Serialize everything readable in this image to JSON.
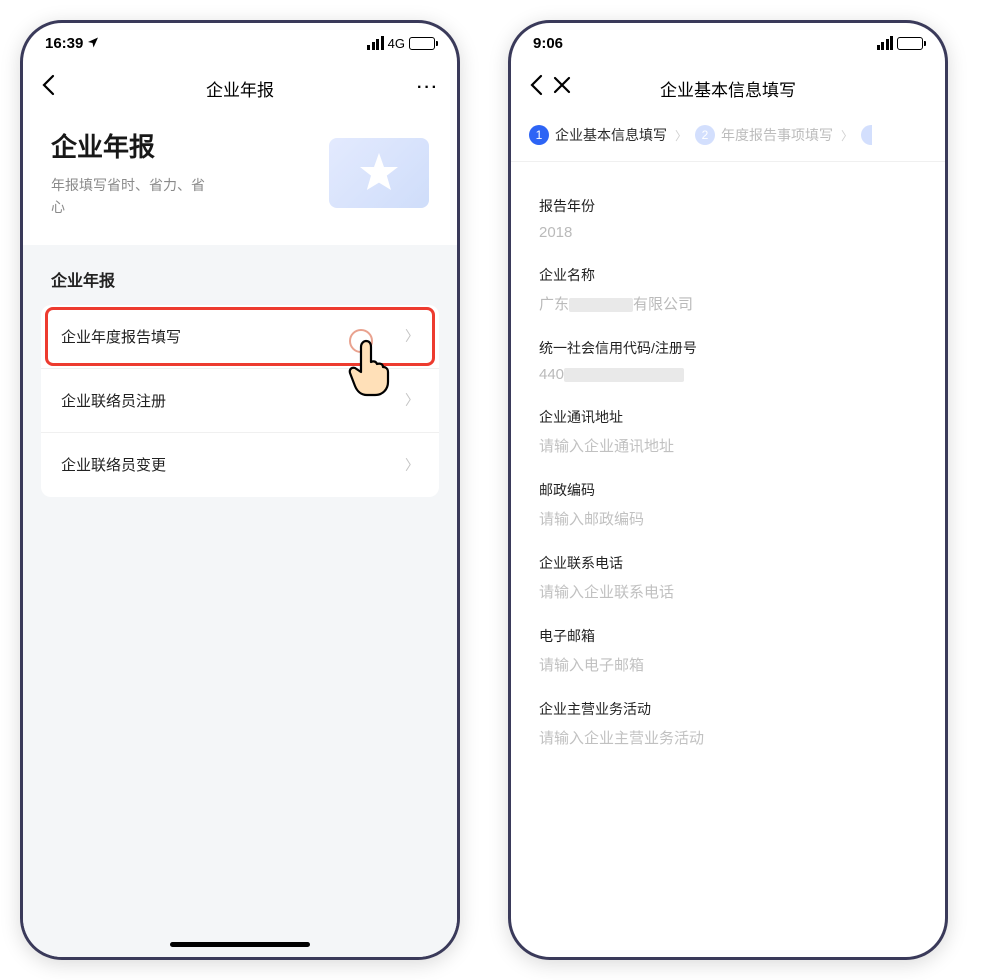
{
  "screen1": {
    "status": {
      "time": "16:39",
      "network": "4G"
    },
    "nav": {
      "title": "企业年报"
    },
    "hero": {
      "title": "企业年报",
      "subtitle": "年报填写省时、省力、省心"
    },
    "section": {
      "title": "企业年报",
      "items": [
        {
          "label": "企业年度报告填写",
          "highlighted": true
        },
        {
          "label": "企业联络员注册",
          "highlighted": false
        },
        {
          "label": "企业联络员变更",
          "highlighted": false
        }
      ]
    }
  },
  "screen2": {
    "status": {
      "time": "9:06"
    },
    "nav": {
      "title": "企业基本信息填写"
    },
    "stepper": {
      "step1": "企业基本信息填写",
      "step2": "年度报告事项填写"
    },
    "form": {
      "year": {
        "label": "报告年份",
        "value": "2018"
      },
      "company": {
        "label": "企业名称",
        "prefix": "广东",
        "suffix": "有限公司"
      },
      "code": {
        "label": "统一社会信用代码/注册号",
        "prefix": "440"
      },
      "address": {
        "label": "企业通讯地址",
        "placeholder": "请输入企业通讯地址"
      },
      "postal": {
        "label": "邮政编码",
        "placeholder": "请输入邮政编码"
      },
      "phone": {
        "label": "企业联系电话",
        "placeholder": "请输入企业联系电话"
      },
      "email": {
        "label": "电子邮箱",
        "placeholder": "请输入电子邮箱"
      },
      "business": {
        "label": "企业主营业务活动",
        "placeholder": "请输入企业主营业务活动"
      }
    }
  }
}
